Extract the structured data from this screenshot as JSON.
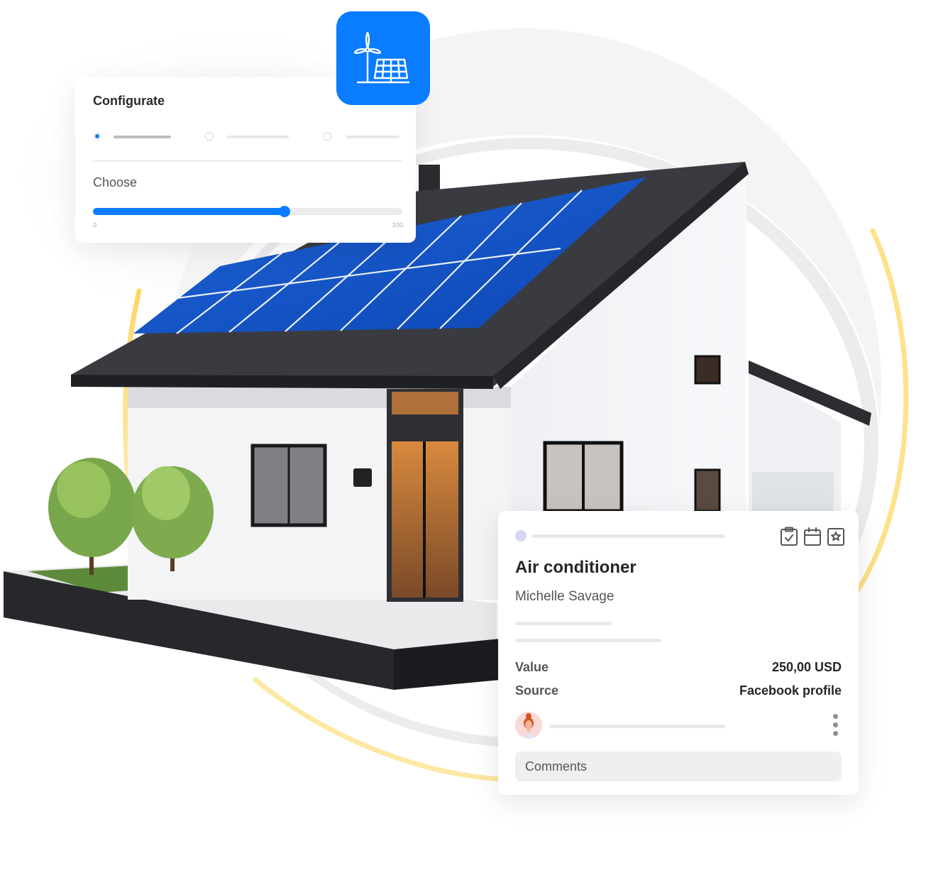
{
  "configurator": {
    "title": "Configurate",
    "options": [
      {
        "selected": true
      },
      {
        "selected": false
      },
      {
        "selected": false
      }
    ],
    "slider": {
      "label": "Choose",
      "min_label": "0",
      "max_label": "100",
      "min": 0,
      "max": 100,
      "value": 62
    }
  },
  "energy_tile": {
    "icon": "wind-turbine-solar-panel-icon",
    "color": "#0a7cff"
  },
  "deal_card": {
    "title": "Air conditioner",
    "person": "Michelle Savage",
    "actions": [
      {
        "icon": "clipboard-check-icon"
      },
      {
        "icon": "calendar-icon"
      },
      {
        "icon": "star-badge-icon"
      }
    ],
    "fields": [
      {
        "label": "Value",
        "value": "250,00 USD"
      },
      {
        "label": "Source",
        "value": "Facebook profile"
      }
    ],
    "comments_placeholder": "Comments",
    "menu_icon": "kebab-menu-icon"
  },
  "colors": {
    "accent": "#0a7cff",
    "arc_yellow": "#fcd55a",
    "text_dark": "#262626",
    "text_muted": "#555555"
  }
}
